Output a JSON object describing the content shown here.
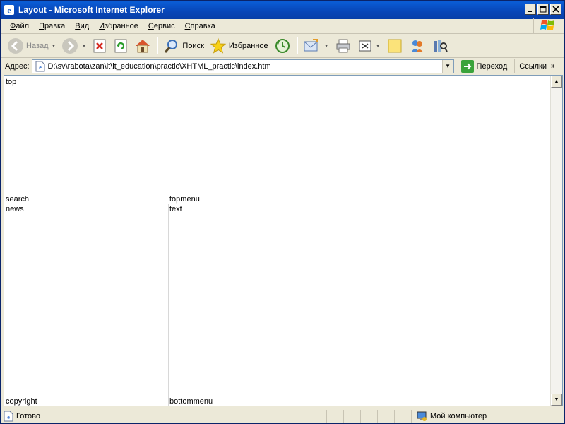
{
  "window": {
    "title": "Layout - Microsoft Internet Explorer"
  },
  "menubar": {
    "items": [
      "Файл",
      "Правка",
      "Вид",
      "Избранное",
      "Сервис",
      "Справка"
    ]
  },
  "toolbar": {
    "back_label": "Назад",
    "search_label": "Поиск",
    "favorites_label": "Избранное"
  },
  "address": {
    "label": "Адрес:",
    "value": "D:\\sv\\rabota\\zan\\it\\it_education\\practic\\XHTML_practic\\index.htm",
    "go_label": "Переход",
    "links_label": "Ссылки"
  },
  "page": {
    "top": "top",
    "search": "search",
    "topmenu": "topmenu",
    "news": "news",
    "text": "text",
    "copyright": "copyright",
    "bottommenu": "bottommenu"
  },
  "status": {
    "text": "Готово",
    "zone": "Мой компьютер"
  },
  "colors": {
    "title_bar": "#0a5fd8",
    "chrome": "#ece9d8",
    "content_bg": "#ffffff",
    "cell_border": "#d8d8d8"
  }
}
